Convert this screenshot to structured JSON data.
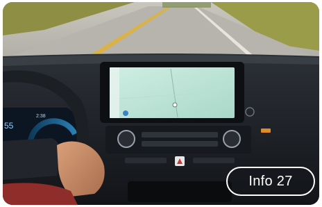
{
  "badge": {
    "label": "Info 27"
  },
  "cluster": {
    "speed": "55",
    "time": "2:38"
  },
  "colors": {
    "sky_road": "#b9b8b2",
    "grass": "#a7a455",
    "dash_dark": "#1b1e23",
    "screen_map": "#bfe3d6",
    "skin": "#c98d66",
    "sleeve": "#9b2e2a"
  },
  "icons": [
    "steering-wheel-icon",
    "hazard-icon",
    "map-location-icon"
  ]
}
